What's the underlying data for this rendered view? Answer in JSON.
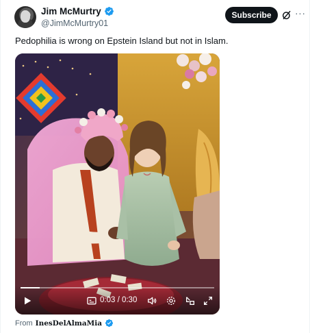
{
  "author": {
    "display_name": "Jim McMurtry",
    "handle": "@JimMcMurtry01",
    "verified_icon": "verified-badge-icon",
    "verified_color": "#1d9bf0"
  },
  "header": {
    "subscribe_label": "Subscribe",
    "grok_icon": "grok-icon",
    "more_icon": "more-options-icon",
    "more_glyph": "···"
  },
  "tweet": {
    "text": "Pedophilia is wrong on Epstein Island but not in Islam."
  },
  "video": {
    "time_display": "0:03 / 0:30",
    "progress_fraction": 0.1,
    "icons": [
      "play-icon",
      "subtitles-icon",
      "volume-icon",
      "settings-icon",
      "picture-in-picture-icon",
      "fullscreen-icon"
    ]
  },
  "source": {
    "prefix": "From",
    "name": "InesDelAlmaMia",
    "verified_icon": "verified-badge-icon"
  },
  "colors": {
    "text_primary": "#0f1419",
    "text_secondary": "#536471",
    "button_bg": "#0f1419",
    "accent": "#1d9bf0"
  }
}
